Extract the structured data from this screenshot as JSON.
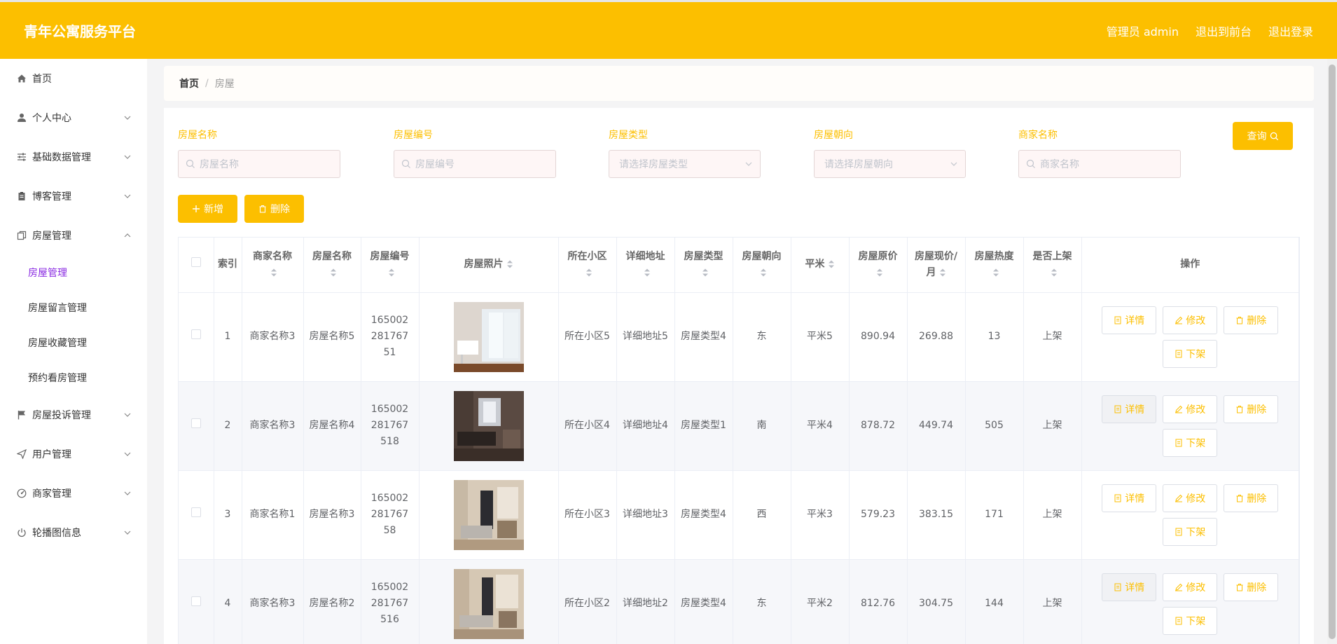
{
  "header": {
    "brand": "青年公寓服务平台",
    "admin": "管理员 admin",
    "to_front": "退出到前台",
    "logout": "退出登录"
  },
  "sidebar": {
    "items": [
      {
        "label": "首页",
        "icon": "home-icon",
        "has_sub": false
      },
      {
        "label": "个人中心",
        "icon": "user-icon",
        "has_sub": true
      },
      {
        "label": "基础数据管理",
        "icon": "sliders-icon",
        "has_sub": true
      },
      {
        "label": "博客管理",
        "icon": "clipboard-icon",
        "has_sub": true
      },
      {
        "label": "房屋管理",
        "icon": "copy-icon",
        "has_sub": true,
        "expanded": true
      },
      {
        "label": "房屋投诉管理",
        "icon": "flag-icon",
        "has_sub": true
      },
      {
        "label": "用户管理",
        "icon": "send-icon",
        "has_sub": true
      },
      {
        "label": "商家管理",
        "icon": "gauge-icon",
        "has_sub": true
      },
      {
        "label": "轮播图信息",
        "icon": "power-icon",
        "has_sub": true
      }
    ],
    "subitems": [
      "房屋管理",
      "房屋留言管理",
      "房屋收藏管理",
      "预约看房管理"
    ]
  },
  "breadcrumb": {
    "home": "首页",
    "sep": "/",
    "current": "房屋"
  },
  "filters": {
    "name_label": "房屋名称",
    "name_placeholder": "房屋名称",
    "code_label": "房屋编号",
    "code_placeholder": "房屋编号",
    "type_label": "房屋类型",
    "type_placeholder": "请选择房屋类型",
    "orient_label": "房屋朝向",
    "orient_placeholder": "请选择房屋朝向",
    "merchant_label": "商家名称",
    "merchant_placeholder": "商家名称",
    "query": "查询"
  },
  "actions": {
    "add": "新增",
    "delete": "删除"
  },
  "table": {
    "headers": {
      "index": "索引",
      "merchant": "商家名称",
      "name": "房屋名称",
      "code": "房屋编号",
      "photo": "房屋照片",
      "community": "所在小区",
      "address": "详细地址",
      "type": "房屋类型",
      "orient": "房屋朝向",
      "area": "平米",
      "orig_price": "房屋原价",
      "cur_price": "房屋现价/月",
      "heat": "房屋热度",
      "listed": "是否上架",
      "ops": "操作"
    },
    "ops": {
      "detail": "详情",
      "edit": "修改",
      "remove": "删除",
      "unlist": "下架"
    },
    "rows": [
      {
        "index": "1",
        "merchant": "商家名称3",
        "name": "房屋名称5",
        "code": "16500228176751",
        "community": "所在小区5",
        "address": "详细地址5",
        "type": "房屋类型4",
        "orient": "东",
        "area": "平米5",
        "orig_price": "890.94",
        "cur_price": "269.88",
        "heat": "13",
        "listed": "上架"
      },
      {
        "index": "2",
        "merchant": "商家名称3",
        "name": "房屋名称4",
        "code": "165002281767518",
        "community": "所在小区4",
        "address": "详细地址4",
        "type": "房屋类型1",
        "orient": "南",
        "area": "平米4",
        "orig_price": "878.72",
        "cur_price": "449.74",
        "heat": "505",
        "listed": "上架"
      },
      {
        "index": "3",
        "merchant": "商家名称1",
        "name": "房屋名称3",
        "code": "16500228176758",
        "community": "所在小区3",
        "address": "详细地址3",
        "type": "房屋类型4",
        "orient": "西",
        "area": "平米3",
        "orig_price": "579.23",
        "cur_price": "383.15",
        "heat": "171",
        "listed": "上架"
      },
      {
        "index": "4",
        "merchant": "商家名称3",
        "name": "房屋名称2",
        "code": "165002281767516",
        "community": "所在小区2",
        "address": "详细地址2",
        "type": "房屋类型4",
        "orient": "东",
        "area": "平米2",
        "orig_price": "812.76",
        "cur_price": "304.75",
        "heat": "144",
        "listed": "上架"
      }
    ]
  },
  "colors": {
    "accent": "#fcbf00",
    "active_sub": "#8a2be2"
  }
}
